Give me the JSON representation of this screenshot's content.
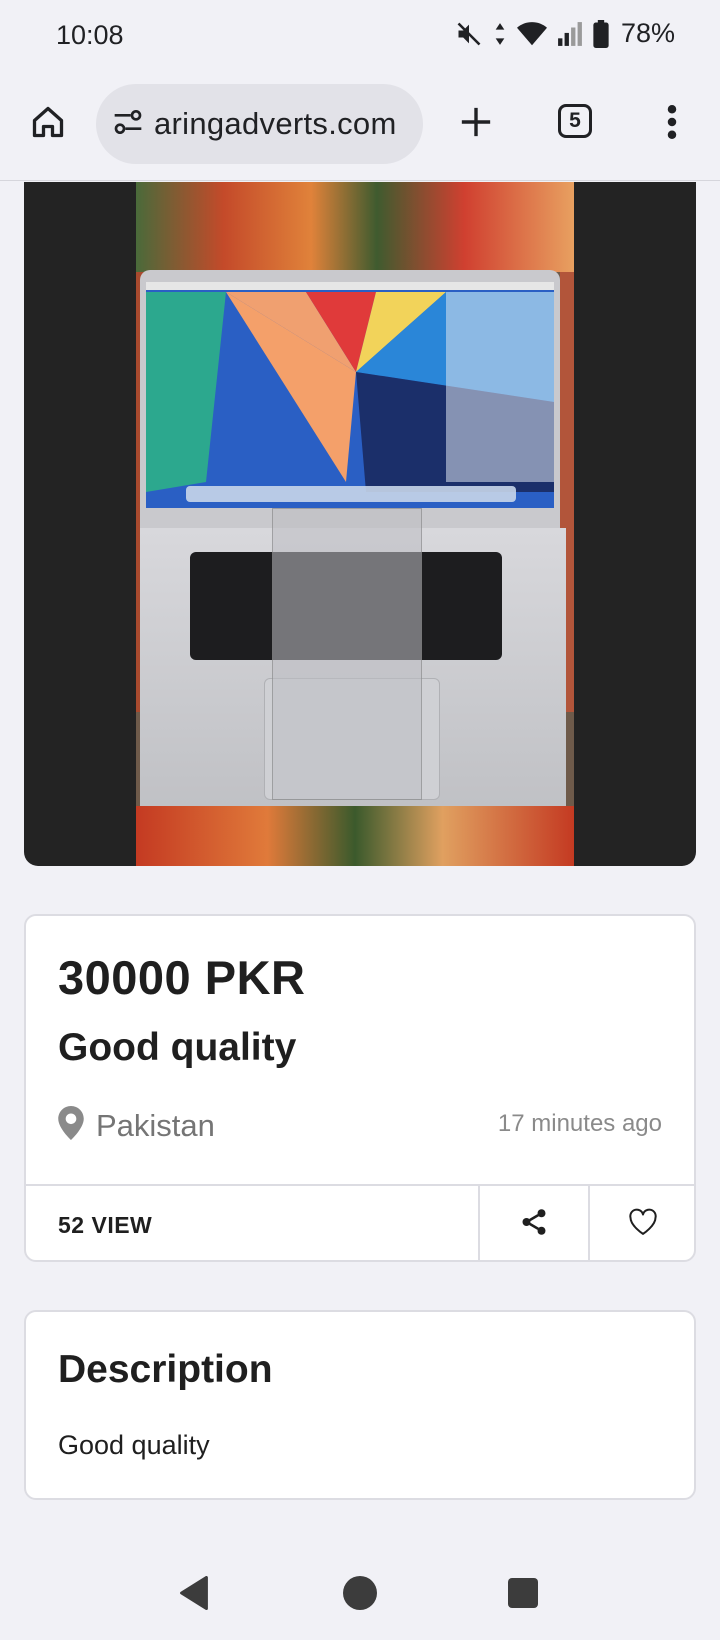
{
  "status_bar": {
    "time": "10:08",
    "battery": "78%",
    "icons": [
      "mute-icon",
      "data-arrows-icon",
      "wifi-icon",
      "signal-icon",
      "battery-icon"
    ]
  },
  "browser": {
    "url": "aringadverts.com",
    "tab_count": "5",
    "icons": [
      "home-icon",
      "site-settings-icon",
      "new-tab-icon",
      "tab-switcher-icon",
      "more-menu-icon"
    ]
  },
  "listing": {
    "price": "30000 PKR",
    "title": "Good quality",
    "location": "Pakistan",
    "posted": "17 minutes ago",
    "views": "52 VIEW"
  },
  "description": {
    "heading": "Description",
    "body": "Good quality"
  },
  "nav": {
    "icons": [
      "back-icon",
      "home-circle-icon",
      "recents-icon"
    ]
  }
}
